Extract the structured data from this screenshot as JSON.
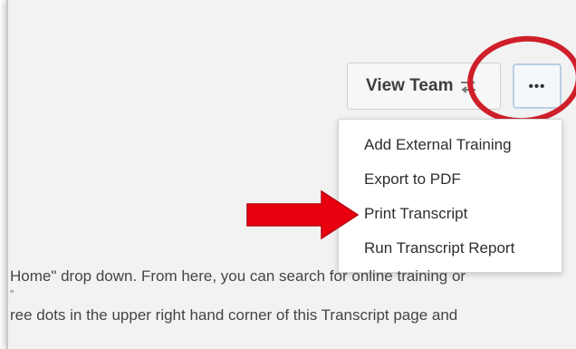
{
  "header": {
    "view_team_label": "View Team",
    "view_team_icon": "swap-arrows-icon",
    "more_label": "•••"
  },
  "menu": {
    "items": [
      {
        "label": "Add External Training"
      },
      {
        "label": "Export to PDF"
      },
      {
        "label": "Print Transcript"
      },
      {
        "label": "Run Transcript Report"
      }
    ]
  },
  "annotations": {
    "highlight_color": "#cf1f2a",
    "arrow_color": "#e8000f"
  },
  "body_text": {
    "line1": "Home\" drop down. From here, you can search for online training or",
    "line2": "”",
    "line3": "ree dots in the upper right hand corner of this Transcript page and"
  }
}
